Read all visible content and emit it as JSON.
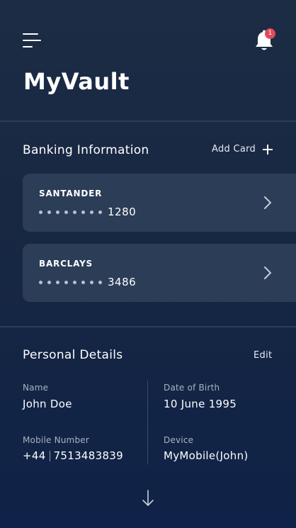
{
  "header": {
    "app_title": "MyVault",
    "notification_count": "1"
  },
  "banking": {
    "title": "Banking Information",
    "add_card_label": "Add Card",
    "cards": [
      {
        "bank": "SANTANDER",
        "last4": "1280"
      },
      {
        "bank": "BARCLAYS",
        "last4": "3486"
      }
    ]
  },
  "personal": {
    "title": "Personal Details",
    "edit_label": "Edit",
    "fields": {
      "name": {
        "label": "Name",
        "value": "John Doe"
      },
      "dob": {
        "label": "Date of Birth",
        "value": "10 June 1995"
      },
      "mobile": {
        "label": "Mobile Number",
        "country_code": "+44",
        "number": "7513483839"
      },
      "device": {
        "label": "Device",
        "value": "MyMobile(John)"
      }
    }
  },
  "colors": {
    "background": "#1c2c45",
    "card": "#2b3d57",
    "badge": "#e24a5a",
    "label": "#a8b3c2"
  },
  "icons": {
    "menu": "menu-icon",
    "notifications": "bell-icon",
    "add": "plus-icon",
    "card_open": "chevron-right-icon",
    "scroll": "arrow-down-icon"
  }
}
